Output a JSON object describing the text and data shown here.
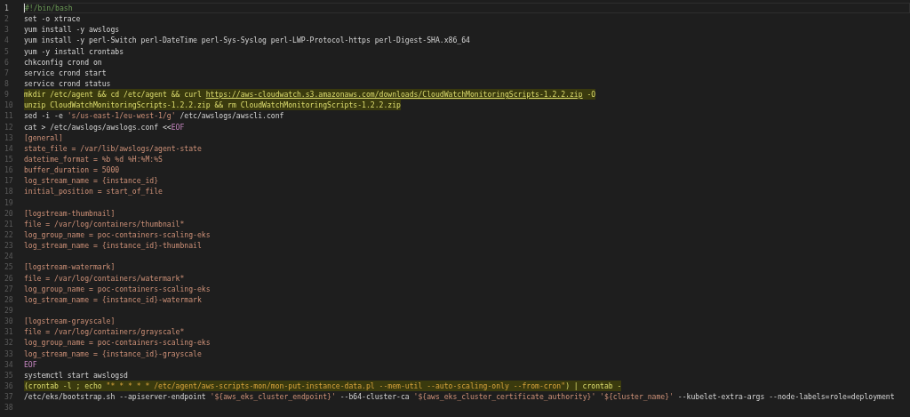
{
  "editor": {
    "lines": [
      {
        "number": "1",
        "cursor": true,
        "highlighted": false,
        "tokens": [
          {
            "kind": "comment",
            "text": "#!/bin/bash"
          }
        ]
      },
      {
        "number": "2",
        "cursor": false,
        "highlighted": false,
        "tokens": [
          {
            "kind": "plain",
            "text": "set -o xtrace"
          }
        ]
      },
      {
        "number": "3",
        "cursor": false,
        "highlighted": false,
        "tokens": [
          {
            "kind": "plain",
            "text": "yum install -y awslogs"
          }
        ]
      },
      {
        "number": "4",
        "cursor": false,
        "highlighted": false,
        "tokens": [
          {
            "kind": "plain",
            "text": "yum install -y perl-Switch perl-DateTime perl-Sys-Syslog perl-LWP-Protocol-https perl-Digest-SHA.x86_64"
          }
        ]
      },
      {
        "number": "5",
        "cursor": false,
        "highlighted": false,
        "tokens": [
          {
            "kind": "plain",
            "text": "yum -y install crontabs"
          }
        ]
      },
      {
        "number": "6",
        "cursor": false,
        "highlighted": false,
        "tokens": [
          {
            "kind": "plain",
            "text": "chkconfig crond on"
          }
        ]
      },
      {
        "number": "7",
        "cursor": false,
        "highlighted": false,
        "tokens": [
          {
            "kind": "plain",
            "text": "service crond start"
          }
        ]
      },
      {
        "number": "8",
        "cursor": false,
        "highlighted": false,
        "tokens": [
          {
            "kind": "plain",
            "text": "service crond status"
          }
        ]
      },
      {
        "number": "9",
        "cursor": false,
        "highlighted": true,
        "tokens": [
          {
            "kind": "plain",
            "text": "mkdir /etc/agent && cd /etc/agent && curl "
          },
          {
            "kind": "url",
            "text": "https://aws-cloudwatch.s3.amazonaws.com/downloads/CloudWatchMonitoringScripts-1.2.2.zip"
          },
          {
            "kind": "plain",
            "text": " -O"
          }
        ]
      },
      {
        "number": "10",
        "cursor": false,
        "highlighted": true,
        "tokens": [
          {
            "kind": "plain",
            "text": "unzip CloudWatchMonitoringScripts-1.2.2.zip && rm CloudWatchMonitoringScripts-1.2.2.zip"
          }
        ]
      },
      {
        "number": "11",
        "cursor": false,
        "highlighted": false,
        "tokens": [
          {
            "kind": "plain",
            "text": "sed -i -e "
          },
          {
            "kind": "string",
            "text": "'s/us-east-1/eu-west-1/g'"
          },
          {
            "kind": "plain",
            "text": " /etc/awslogs/awscli.conf"
          }
        ]
      },
      {
        "number": "12",
        "cursor": false,
        "highlighted": false,
        "tokens": [
          {
            "kind": "plain",
            "text": "cat > /etc/awslogs/awslogs.conf <<"
          },
          {
            "kind": "keyword",
            "text": "EOF"
          }
        ]
      },
      {
        "number": "13",
        "cursor": false,
        "highlighted": false,
        "tokens": [
          {
            "kind": "string",
            "text": "[general]"
          }
        ]
      },
      {
        "number": "14",
        "cursor": false,
        "highlighted": false,
        "tokens": [
          {
            "kind": "string",
            "text": "state_file = /var/lib/awslogs/agent-state"
          }
        ]
      },
      {
        "number": "15",
        "cursor": false,
        "highlighted": false,
        "tokens": [
          {
            "kind": "string",
            "text": "datetime_format = %b %d %H:%M:%S"
          }
        ]
      },
      {
        "number": "16",
        "cursor": false,
        "highlighted": false,
        "tokens": [
          {
            "kind": "string",
            "text": "buffer_duration = 5000"
          }
        ]
      },
      {
        "number": "17",
        "cursor": false,
        "highlighted": false,
        "tokens": [
          {
            "kind": "string",
            "text": "log_stream_name = {instance_id}"
          }
        ]
      },
      {
        "number": "18",
        "cursor": false,
        "highlighted": false,
        "tokens": [
          {
            "kind": "string",
            "text": "initial_position = start_of_file"
          }
        ]
      },
      {
        "number": "19",
        "cursor": false,
        "highlighted": false
      },
      {
        "number": "20",
        "cursor": false,
        "highlighted": false,
        "tokens": [
          {
            "kind": "string",
            "text": "[logstream-thumbnail]"
          }
        ]
      },
      {
        "number": "21",
        "cursor": false,
        "highlighted": false,
        "tokens": [
          {
            "kind": "string",
            "text": "file = /var/log/containers/thumbnail*"
          }
        ]
      },
      {
        "number": "22",
        "cursor": false,
        "highlighted": false,
        "tokens": [
          {
            "kind": "string",
            "text": "log_group_name = poc-containers-scaling-eks"
          }
        ]
      },
      {
        "number": "23",
        "cursor": false,
        "highlighted": false,
        "tokens": [
          {
            "kind": "string",
            "text": "log_stream_name = {instance_id}-thumbnail"
          }
        ]
      },
      {
        "number": "24",
        "cursor": false,
        "highlighted": false
      },
      {
        "number": "25",
        "cursor": false,
        "highlighted": false,
        "tokens": [
          {
            "kind": "string",
            "text": "[logstream-watermark]"
          }
        ]
      },
      {
        "number": "26",
        "cursor": false,
        "highlighted": false,
        "tokens": [
          {
            "kind": "string",
            "text": "file = /var/log/containers/watermark*"
          }
        ]
      },
      {
        "number": "27",
        "cursor": false,
        "highlighted": false,
        "tokens": [
          {
            "kind": "string",
            "text": "log_group_name = poc-containers-scaling-eks"
          }
        ]
      },
      {
        "number": "28",
        "cursor": false,
        "highlighted": false,
        "tokens": [
          {
            "kind": "string",
            "text": "log_stream_name = {instance_id}-watermark"
          }
        ]
      },
      {
        "number": "29",
        "cursor": false,
        "highlighted": false
      },
      {
        "number": "30",
        "cursor": false,
        "highlighted": false,
        "tokens": [
          {
            "kind": "string",
            "text": "[logstream-grayscale]"
          }
        ]
      },
      {
        "number": "31",
        "cursor": false,
        "highlighted": false,
        "tokens": [
          {
            "kind": "string",
            "text": "file = /var/log/containers/grayscale*"
          }
        ]
      },
      {
        "number": "32",
        "cursor": false,
        "highlighted": false,
        "tokens": [
          {
            "kind": "string",
            "text": "log_group_name = poc-containers-scaling-eks"
          }
        ]
      },
      {
        "number": "33",
        "cursor": false,
        "highlighted": false,
        "tokens": [
          {
            "kind": "string",
            "text": "log_stream_name = {instance_id}-grayscale"
          }
        ]
      },
      {
        "number": "34",
        "cursor": false,
        "highlighted": false,
        "tokens": [
          {
            "kind": "keyword",
            "text": "EOF"
          }
        ]
      },
      {
        "number": "35",
        "cursor": false,
        "highlighted": false,
        "tokens": [
          {
            "kind": "plain",
            "text": "systemctl start awslogsd"
          }
        ]
      },
      {
        "number": "36",
        "cursor": false,
        "highlighted": true,
        "tokens": [
          {
            "kind": "plain",
            "text": "(crontab -l ; echo "
          },
          {
            "kind": "string",
            "text": "\"* * * * * /etc/agent/aws-scripts-mon/mon-put-instance-data.pl --mem-util --auto-scaling-only --from-cron\""
          },
          {
            "kind": "plain",
            "text": ") | crontab -"
          }
        ]
      },
      {
        "number": "37",
        "cursor": false,
        "highlighted": false,
        "tokens": [
          {
            "kind": "plain",
            "text": "/etc/eks/bootstrap.sh --apiserver-endpoint "
          },
          {
            "kind": "string",
            "text": "'${aws_eks_cluster_endpoint}'"
          },
          {
            "kind": "plain",
            "text": " --b64-cluster-ca "
          },
          {
            "kind": "string",
            "text": "'${aws_eks_cluster_certificate_authority}'"
          },
          {
            "kind": "string",
            "text": " '${cluster_name}'"
          },
          {
            "kind": "plain",
            "text": " --kubelet-extra-args --node-labels=role=deployment"
          }
        ]
      },
      {
        "number": "38",
        "cursor": false,
        "highlighted": false
      }
    ]
  }
}
